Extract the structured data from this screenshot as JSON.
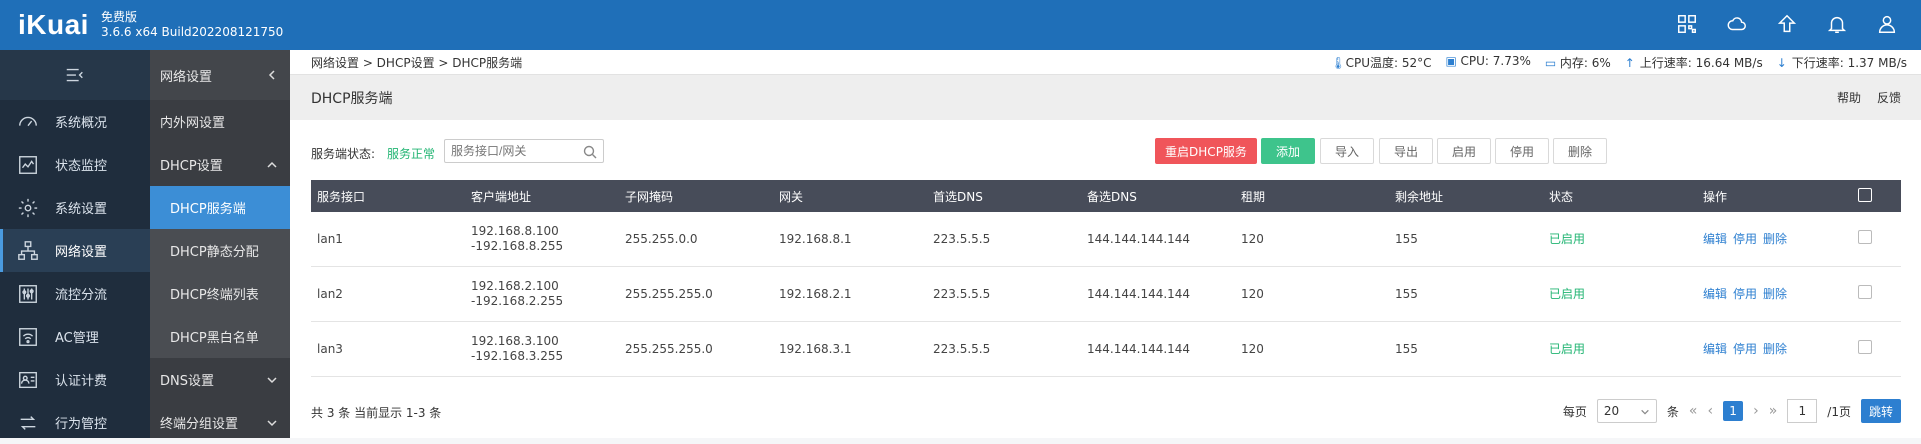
{
  "brand": {
    "logo_text": "iKuai",
    "edition": "免费版",
    "build": "3.6.6 x64 Build202208121750"
  },
  "sidebar": {
    "items": [
      {
        "label": "系统概况",
        "icon": "gauge-icon"
      },
      {
        "label": "状态监控",
        "icon": "chart-icon"
      },
      {
        "label": "系统设置",
        "icon": "gear-icon"
      },
      {
        "label": "网络设置",
        "icon": "network-icon",
        "active": true
      },
      {
        "label": "流控分流",
        "icon": "sliders-icon"
      },
      {
        "label": "AC管理",
        "icon": "wifi-icon"
      },
      {
        "label": "认证计费",
        "icon": "id-card-icon"
      },
      {
        "label": "行为管控",
        "icon": "arrows-icon"
      }
    ]
  },
  "subnav": {
    "header": "网络设置",
    "rows": [
      {
        "label": "内外网设置"
      },
      {
        "label": "DHCP设置"
      },
      {
        "label": "DHCP服务端",
        "child": true,
        "active": true
      },
      {
        "label": "DHCP静态分配",
        "child": true
      },
      {
        "label": "DHCP终端列表",
        "child": true
      },
      {
        "label": "DHCP黑白名单",
        "child": true
      },
      {
        "label": "DNS设置"
      },
      {
        "label": "终端分组设置"
      }
    ]
  },
  "breadcrumb": "网络设置 > DHCP设置 > DHCP服务端",
  "stats": {
    "cpu_temp": "CPU温度: 52°C",
    "cpu": "CPU: 7.73%",
    "mem": "内存: 6%",
    "up": "上行速率: 16.64 MB/s",
    "down": "下行速率: 1.37 MB/s"
  },
  "page": {
    "title": "DHCP服务端",
    "help": "帮助",
    "feedback": "反馈"
  },
  "toolbar": {
    "status_label": "服务端状态:",
    "status_value": "服务正常",
    "search_placeholder": "服务接口/网关",
    "restart": "重启DHCP服务",
    "add": "添加",
    "import": "导入",
    "export": "导出",
    "enable": "启用",
    "disable": "停用",
    "delete": "删除"
  },
  "table": {
    "headers": [
      "服务接口",
      "客户端地址",
      "子网掩码",
      "网关",
      "首选DNS",
      "备选DNS",
      "租期",
      "剩余地址",
      "状态",
      "操作"
    ],
    "rows": [
      {
        "iface": "lan1",
        "addr1": "192.168.8.100",
        "addr2": "-192.168.8.255",
        "mask": "255.255.0.0",
        "gw": "192.168.8.1",
        "dns1": "223.5.5.5",
        "dns2": "144.144.144.144",
        "lease": "120",
        "remain": "155",
        "status": "已启用"
      },
      {
        "iface": "lan2",
        "addr1": "192.168.2.100",
        "addr2": "-192.168.2.255",
        "mask": "255.255.255.0",
        "gw": "192.168.2.1",
        "dns1": "223.5.5.5",
        "dns2": "144.144.144.144",
        "lease": "120",
        "remain": "155",
        "status": "已启用"
      },
      {
        "iface": "lan3",
        "addr1": "192.168.3.100",
        "addr2": "-192.168.3.255",
        "mask": "255.255.255.0",
        "gw": "192.168.3.1",
        "dns1": "223.5.5.5",
        "dns2": "144.144.144.144",
        "lease": "120",
        "remain": "155",
        "status": "已启用"
      }
    ],
    "ops": {
      "edit": "编辑",
      "disable": "停用",
      "delete": "删除"
    }
  },
  "footer": {
    "total": "共 3 条 当前显示 1-3 条",
    "per_page_label": "每页",
    "per_page_value": "20",
    "per_page_unit": "条",
    "current_page": "1",
    "jump_value": "1",
    "page_total": "/1页",
    "go": "跳转"
  }
}
